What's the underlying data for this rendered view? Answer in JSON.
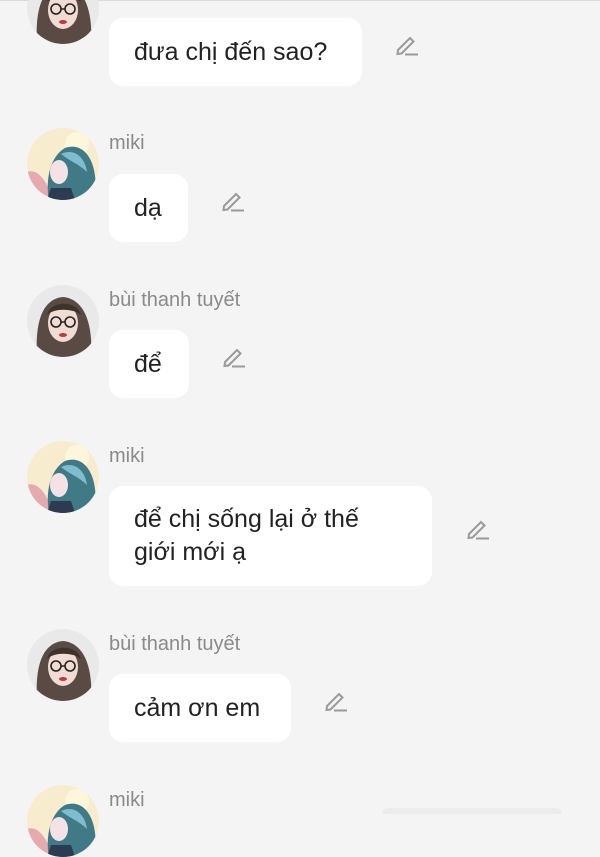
{
  "conversation": {
    "messages": [
      {
        "sender": "",
        "text": "đưa chị đến sao?",
        "avatar": "girl-glasses-avatar"
      },
      {
        "sender": "miki",
        "text": "dạ",
        "avatar": "anime-teal-hair-avatar"
      },
      {
        "sender": "bùi thanh tuyết",
        "text": "để",
        "avatar": "girl-glasses-avatar"
      },
      {
        "sender": "miki",
        "text": "để chị sống lại ở thế giới mới ạ",
        "avatar": "anime-teal-hair-avatar"
      },
      {
        "sender": "bùi thanh tuyết",
        "text": "cảm ơn em",
        "avatar": "girl-glasses-avatar"
      },
      {
        "sender": "miki",
        "text": "",
        "avatar": "anime-teal-hair-avatar"
      }
    ]
  },
  "colors": {
    "background": "#f4f4f4",
    "bubble": "#ffffff",
    "sender_name": "#8a8a8a",
    "message_text": "#222222",
    "edit_icon": "#9a9a9a"
  }
}
